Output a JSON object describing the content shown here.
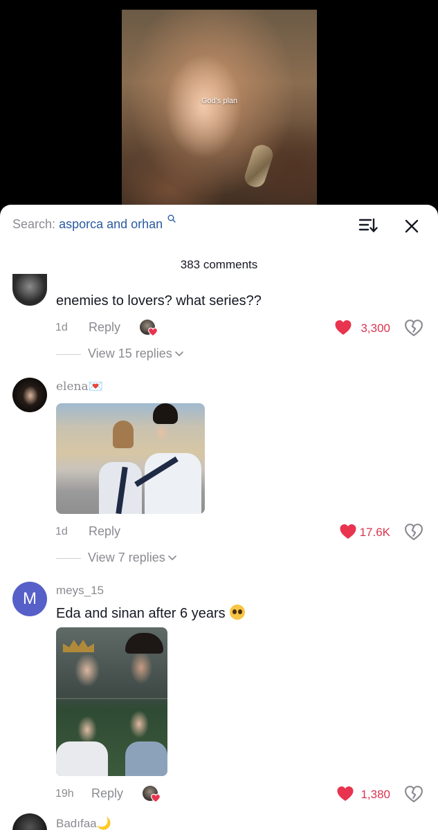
{
  "video": {
    "caption": "God's plan"
  },
  "search": {
    "prefix": "Search:",
    "term": "asporca and orhan"
  },
  "comments_header": {
    "count_label": "383 comments"
  },
  "comments": [
    {
      "username": "",
      "text": "enemies to lovers? what series??",
      "time": "1d",
      "reply_label": "Reply",
      "likes": "3,300",
      "view_replies": "View 15 replies"
    },
    {
      "username": "elena💌",
      "text": "",
      "time": "1d",
      "reply_label": "Reply",
      "likes": "17.6K",
      "view_replies": "View 7 replies"
    },
    {
      "avatar_letter": "M",
      "username": "meys_15",
      "text": "Eda and sinan after 6 years",
      "time": "19h",
      "reply_label": "Reply",
      "likes": "1,380"
    },
    {
      "username": "Badıfaa🌙"
    }
  ],
  "colors": {
    "like_red": "#d8344f",
    "search_blue": "#2a5aa0",
    "muted_gray": "#8a8b91",
    "avatar_purple": "#5660c8"
  },
  "icons": {
    "search": "search-icon",
    "sort": "sort-icon",
    "close": "close-icon",
    "like": "heart-icon",
    "dislike": "broken-heart-icon",
    "expand": "chevron-down-icon"
  }
}
